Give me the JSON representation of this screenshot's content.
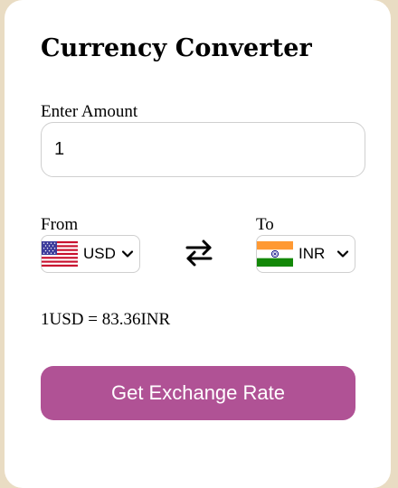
{
  "app": {
    "title": "Currency Converter"
  },
  "amount": {
    "label": "Enter Amount",
    "value": "1"
  },
  "from": {
    "label": "From",
    "currency": "USD",
    "flag": "us-flag-icon"
  },
  "to": {
    "label": "To",
    "currency": "INR",
    "flag": "india-flag-icon"
  },
  "swap_icon": "swap-arrows-icon",
  "result": {
    "text": "1USD = 83.36INR"
  },
  "action": {
    "label": "Get Exchange Rate"
  },
  "colors": {
    "page_background": "#e9dcc3",
    "card_background": "#ffffff",
    "button": "#b05295",
    "button_text": "#ffffff"
  }
}
